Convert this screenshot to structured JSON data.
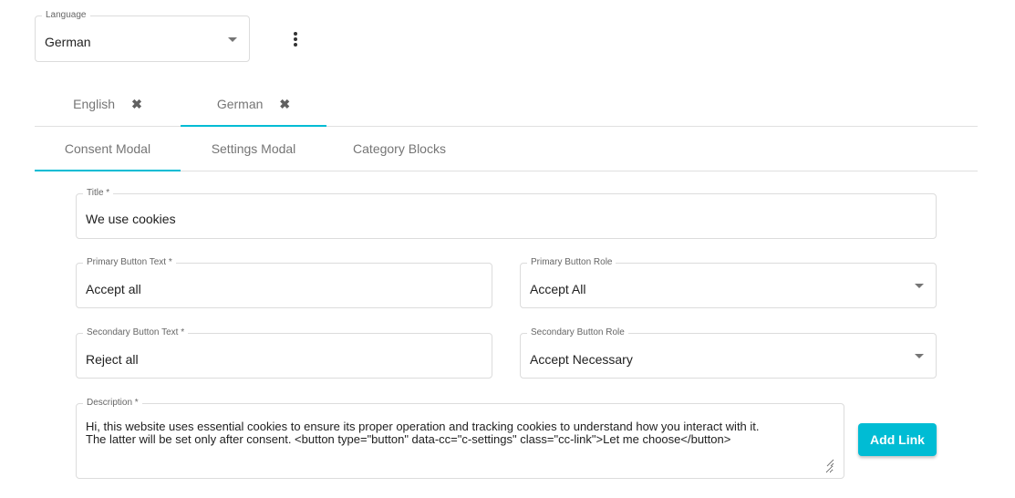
{
  "language_select": {
    "label": "Language",
    "value": "German"
  },
  "more_menu": {
    "icon": "more-vert-icon"
  },
  "language_tabs": [
    {
      "label": "English",
      "close_icon": "close-icon",
      "active": false
    },
    {
      "label": "German",
      "close_icon": "close-icon",
      "active": true
    }
  ],
  "section_tabs": [
    {
      "label": "Consent Modal",
      "active": true
    },
    {
      "label": "Settings Modal",
      "active": false
    },
    {
      "label": "Category Blocks",
      "active": false
    }
  ],
  "form": {
    "title": {
      "label": "Title *",
      "value": "We use cookies"
    },
    "primary_button_text": {
      "label": "Primary Button Text *",
      "value": "Accept all"
    },
    "primary_button_role": {
      "label": "Primary Button Role",
      "value": "Accept All"
    },
    "secondary_button_text": {
      "label": "Secondary Button Text *",
      "value": "Reject all"
    },
    "secondary_button_role": {
      "label": "Secondary Button Role",
      "value": "Accept Necessary"
    },
    "description": {
      "label": "Description *",
      "value": "Hi, this website uses essential cookies to ensure its proper operation and tracking cookies to understand how you interact with it.\nThe latter will be set only after consent. <button type=\"button\" data-cc=\"c-settings\" class=\"cc-link\">Let me choose</button>"
    },
    "add_link_label": "Add Link"
  },
  "colors": {
    "accent": "#00bcd4",
    "border": "#dcdcdc",
    "tab_text": "#757575"
  }
}
